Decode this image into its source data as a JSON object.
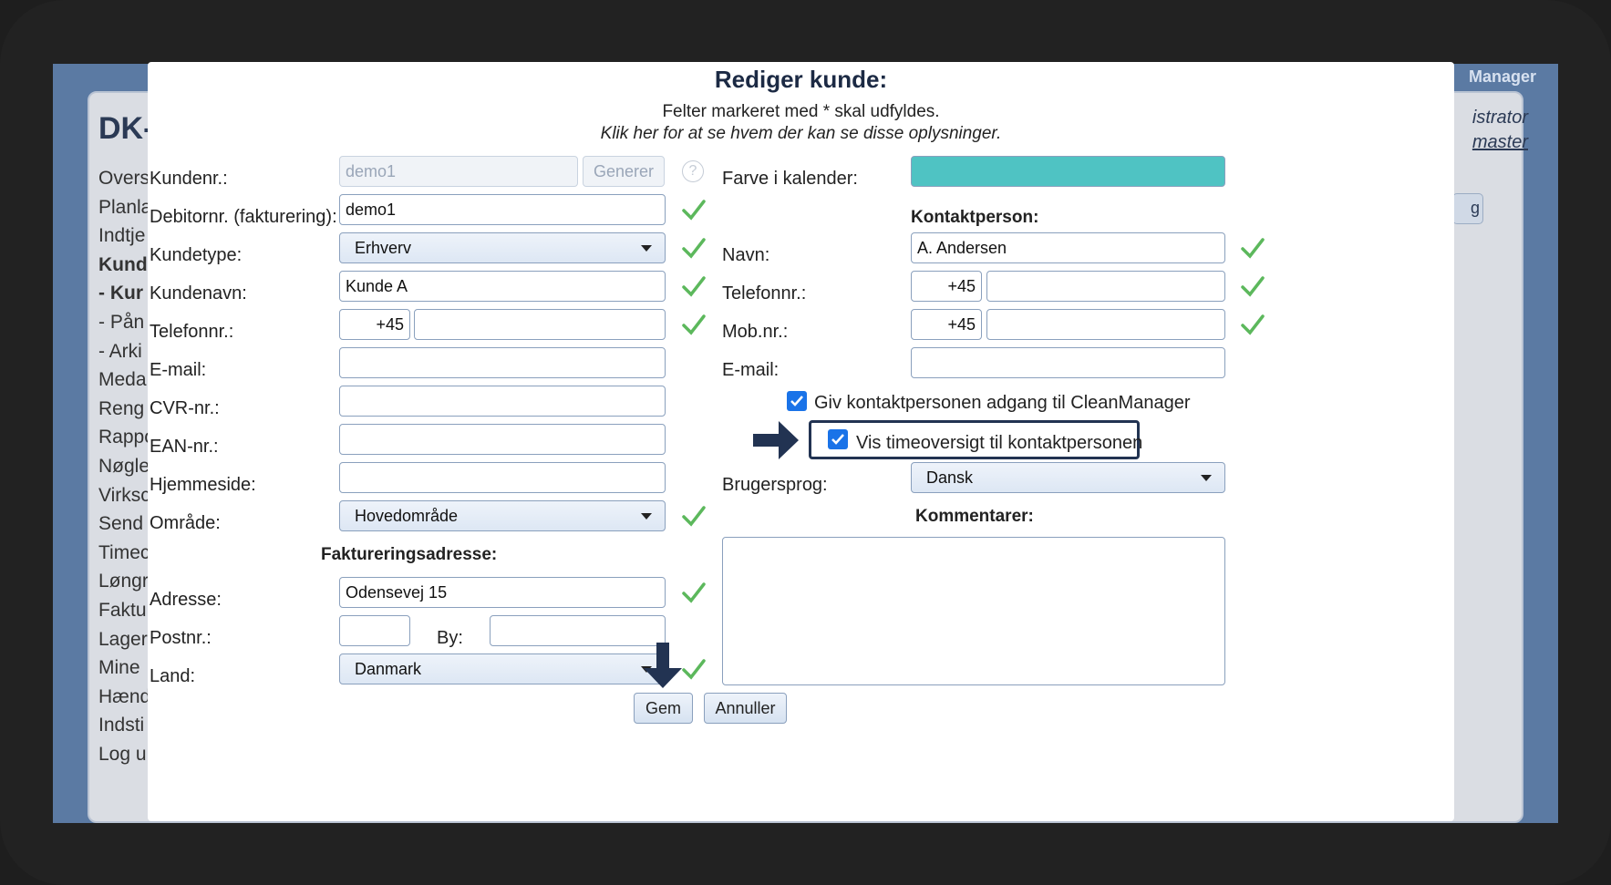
{
  "background": {
    "logo": "DK-",
    "app_title": "Manager",
    "admin_line1": "istrator",
    "admin_line2": "master",
    "right_button": "g",
    "menu": [
      "Overs",
      "Planlæ",
      "Indtje",
      "Kund",
      "- Kur",
      "- Pån",
      "- Arki",
      "Meda",
      "Reng",
      "Rappo",
      "Nøgle",
      "Virksc",
      "Send",
      "Timec",
      "Løngr",
      "Faktu",
      "Lager",
      "Mine",
      "Hænd",
      "Indsti",
      "Log u"
    ]
  },
  "modal": {
    "title": "Rediger kunde:",
    "subtitle_required": "Felter markeret med * skal udfyldes.",
    "subtitle_link": "Klik her for at se hvem der kan se disse oplysninger."
  },
  "left": {
    "kundenr": {
      "label": "Kundenr.:",
      "value": "demo1",
      "generate_button": "Generer"
    },
    "debitornr": {
      "label": "Debitornr. (fakturering):",
      "value": "demo1"
    },
    "kundetype": {
      "label": "Kundetype:",
      "value": "Erhverv"
    },
    "kundenavn": {
      "label": "Kundenavn:",
      "value": "Kunde A"
    },
    "telefon": {
      "label": "Telefonnr.:",
      "prefix": "+45",
      "value": ""
    },
    "email": {
      "label": "E-mail:",
      "value": ""
    },
    "cvr": {
      "label": "CVR-nr.:",
      "value": ""
    },
    "ean": {
      "label": "EAN-nr.:",
      "value": ""
    },
    "hjemmeside": {
      "label": "Hjemmeside:",
      "value": ""
    },
    "omraade": {
      "label": "Område:",
      "value": "Hovedområde"
    },
    "billing_header": "Faktureringsadresse:",
    "adresse": {
      "label": "Adresse:",
      "value": "Odensevej 15"
    },
    "postnr": {
      "label": "Postnr.:",
      "value": ""
    },
    "by": {
      "label": "By:",
      "value": ""
    },
    "land": {
      "label": "Land:",
      "value": "Danmark"
    }
  },
  "right": {
    "farve": {
      "label": "Farve i kalender:",
      "color": "#4fc3c3"
    },
    "contact_header": "Kontaktperson:",
    "navn": {
      "label": "Navn:",
      "value": "A. Andersen"
    },
    "telefon": {
      "label": "Telefonnr.:",
      "prefix": "+45",
      "value": ""
    },
    "mobil": {
      "label": "Mob.nr.:",
      "prefix": "+45",
      "value": ""
    },
    "email": {
      "label": "E-mail:",
      "value": ""
    },
    "give_access": {
      "label": "Giv kontaktpersonen adgang til CleanManager",
      "checked": true
    },
    "show_timesheet": {
      "label": "Vis timeoversigt til kontaktpersonen",
      "checked": true
    },
    "sprog": {
      "label": "Brugersprog:",
      "value": "Dansk"
    },
    "comments_header": "Kommentarer:",
    "comments": ""
  },
  "actions": {
    "save": "Gem",
    "cancel": "Annuller"
  },
  "colors": {
    "accent": "#223352",
    "check": "#5cb85c",
    "checkbox": "#1a73e8"
  }
}
